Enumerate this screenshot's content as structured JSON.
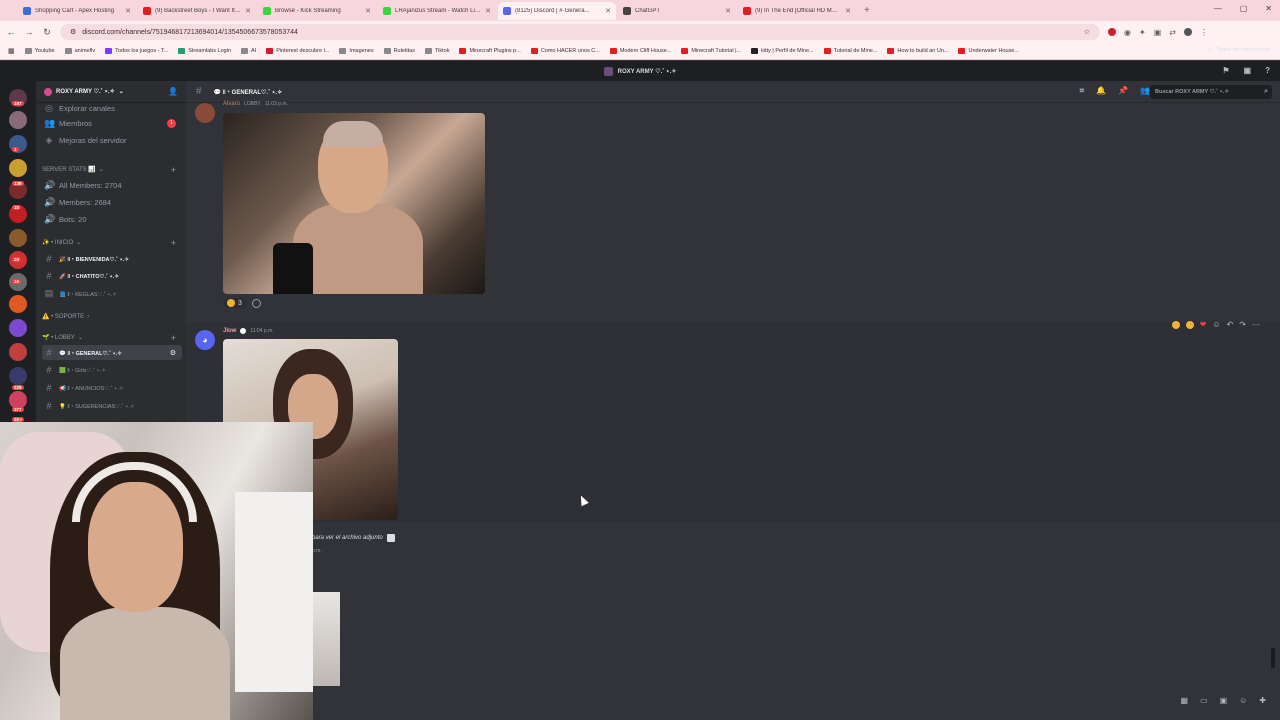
{
  "browser": {
    "tabs": [
      {
        "title": "Shopping Cart - Apex Hosting",
        "color": "#3b6fd8"
      },
      {
        "title": "(9) Backstreet Boys - I Want It That Way",
        "color": "#e02020"
      },
      {
        "title": "Browse - Kick Streaming",
        "color": "#37d83f"
      },
      {
        "title": "LRAjanizus Stream - Watch Live",
        "color": "#37d83f"
      },
      {
        "title": "(8125) Discord | #·Genera...",
        "color": "#5865f2"
      },
      {
        "title": "ChatGPT",
        "color": "#444444"
      },
      {
        "title": "(9) In The End [Official HD Music Video]",
        "color": "#e02020"
      }
    ],
    "active_tab": 4,
    "url": "discord.com/channels/751946817213694014/1354506673578053744",
    "bookmarks": [
      {
        "label": "Youtube",
        "color": "#888"
      },
      {
        "label": "animeflv",
        "color": "#888"
      },
      {
        "label": "Todos los juegos - T...",
        "color": "#7a3cff"
      },
      {
        "label": "Streamlabs Login",
        "color": "#2a9a6a"
      },
      {
        "label": "AI",
        "color": "#888"
      },
      {
        "label": "Pinterest descubre i...",
        "color": "#d01c2c"
      },
      {
        "label": "Imagenes",
        "color": "#888"
      },
      {
        "label": "Ruletitas",
        "color": "#888"
      },
      {
        "label": "Tiktok",
        "color": "#888"
      },
      {
        "label": "Minecraft Plugins p...",
        "color": "#e02020"
      },
      {
        "label": "Como HACER unos C...",
        "color": "#e02020"
      },
      {
        "label": "Modern Cliff House...",
        "color": "#e02020"
      },
      {
        "label": "Minecraft Tutorial |...",
        "color": "#e02020"
      },
      {
        "label": "kitty | Perfil de Mine...",
        "color": "#222"
      },
      {
        "label": "Tutorial de Mine...",
        "color": "#e02020"
      },
      {
        "label": "How to build an Un...",
        "color": "#e02020"
      },
      {
        "label": "Underwater House...",
        "color": "#e02020"
      }
    ],
    "bookmarks_all": "Todos los marcadores"
  },
  "discord": {
    "window_title": "ROXY ARMY ♡.˚ ⋆.✧",
    "server_name": "ROXY ARMY ♡.˚ ⋆.✧",
    "channel_title": "💬 ‖・GENERAL♡.˚ ⋆.✧",
    "search_placeholder": "Buscar ROXY ARMY ♡.˚ ⋆.✧",
    "guild_badges": [
      "197",
      "1",
      "138",
      "10",
      "20",
      "16",
      "229",
      "377",
      "2K+"
    ],
    "channels": {
      "explore": "Explorar canales",
      "members": "Miembros",
      "members_badge": "1",
      "boosts": "Mejoras del servidor",
      "cat_stats": "SERVER STATS 📊",
      "all_members": "All Members: 2704",
      "members_count": "Members: 2684",
      "bots": "Bots: 20",
      "cat_inicio": "✨ • INICIO",
      "bienvenida": "🎉 ‖・BIENVENIDA♡.˚ ⋆.✧",
      "chatito": "🚀 ‖・CHATITO♡.˚ ⋆.✧",
      "reglas": "📘 ‖・REGLAS♡.˚ ⋆.✧",
      "cat_soporte": "⚠️ • SOPORTE",
      "cat_lobby": "🌱 • LOBBY",
      "general": "💬 ‖・GENERAL♡.˚ ⋆.✧",
      "girls": "🟩 ‖・Girls♡.˚ ⋆.✧",
      "anuncios": "📢 ‖・ANUNCIOS♡.˚ ⋆.✧",
      "sugerencias": "💡 ‖・SUGERENCIAS♡.˚ ⋆.✧"
    },
    "messages": [
      {
        "author": "Alvaro",
        "tag": "LOBBY",
        "time": "11:03 p.m.",
        "reaction_count": "3"
      },
      {
        "author": "Jlow",
        "time": "11:04 p.m."
      }
    ],
    "attachment_text": "para ver el archivo adjunto",
    "attachment_sub": "p.m."
  }
}
